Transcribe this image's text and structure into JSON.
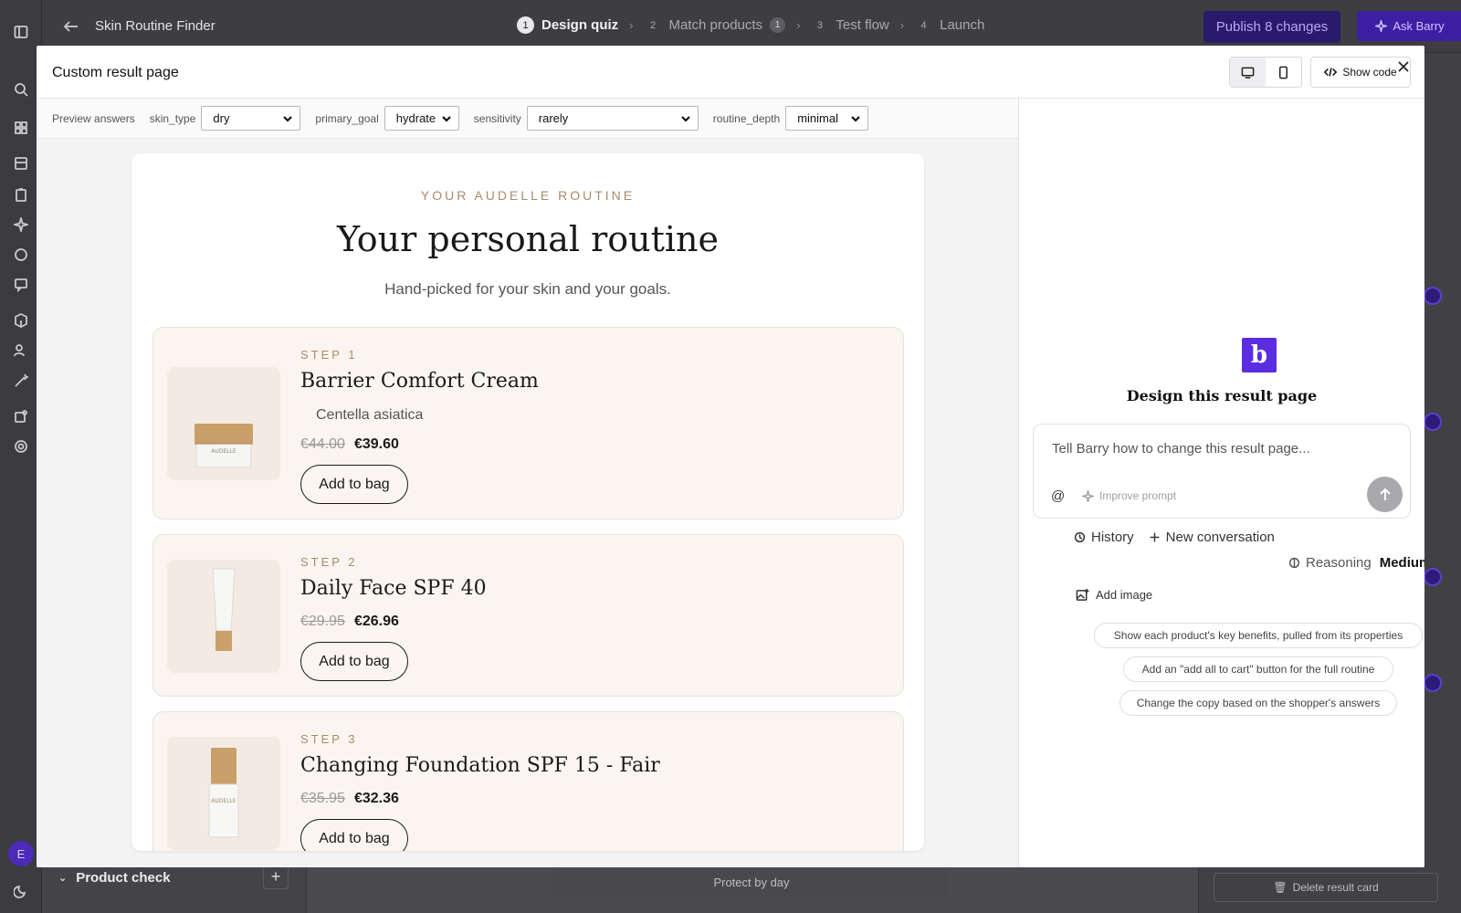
{
  "app": {
    "title": "Skin Routine Finder",
    "steps": [
      {
        "num": "1",
        "label": "Design quiz"
      },
      {
        "num": "2",
        "label": "Match products",
        "badge": "1"
      },
      {
        "num": "3",
        "label": "Test flow"
      },
      {
        "num": "4",
        "label": "Launch"
      }
    ],
    "publish_label": "Publish 8 changes",
    "ask_label": "Ask Barry",
    "avatar_initial": "E",
    "left_panel": {
      "section_label": "Product check",
      "add_label": "+"
    },
    "canvas_label": "Protect by day",
    "right_panel": {
      "delete_label": "Delete result card"
    }
  },
  "modal": {
    "title": "Custom result page",
    "show_code_label": "Show code",
    "preview_answers_label": "Preview answers",
    "answers": [
      {
        "key": "skin_type",
        "value": "dry"
      },
      {
        "key": "primary_goal",
        "value": "hydrate"
      },
      {
        "key": "sensitivity",
        "value": "rarely"
      },
      {
        "key": "routine_depth",
        "value": "minimal"
      }
    ]
  },
  "result": {
    "eyebrow": "YOUR AUDELLE ROUTINE",
    "headline": "Your personal routine",
    "subhead": "Hand-picked for your skin and your goals.",
    "button_label": "Add to bag",
    "brand_mark": "AUDELLE",
    "products": [
      {
        "step": "STEP 1",
        "name": "Barrier Comfort Cream",
        "ingredient": "Centella asiatica",
        "old_price": "€44.00",
        "new_price": "€39.60"
      },
      {
        "step": "STEP 2",
        "name": "Daily Face SPF 40",
        "ingredient": "",
        "old_price": "€29.95",
        "new_price": "€26.96"
      },
      {
        "step": "STEP 3",
        "name": "Changing Foundation SPF 15 - Fair",
        "ingredient": "",
        "old_price": "€35.95",
        "new_price": "€32.36"
      }
    ]
  },
  "assistant": {
    "logo_letter": "b",
    "title": "Design this result page",
    "prompt_placeholder": "Tell Barry how to change this result page...",
    "at_symbol": "@",
    "improve_label": "Improve prompt",
    "history_label": "History",
    "new_conversation_label": "New conversation",
    "reasoning_label": "Reasoning",
    "reasoning_value": "Medium",
    "add_image_label": "Add image",
    "suggestions": [
      "Show each product's key benefits, pulled from its properties",
      "Add an \"add all to cart\" button for the full routine",
      "Change the copy based on the shopper's answers"
    ]
  },
  "colors": {
    "accent_purple": "#5b2de0",
    "eyebrow_gold": "#a98a69",
    "product_card_bg": "#faf5f0"
  }
}
